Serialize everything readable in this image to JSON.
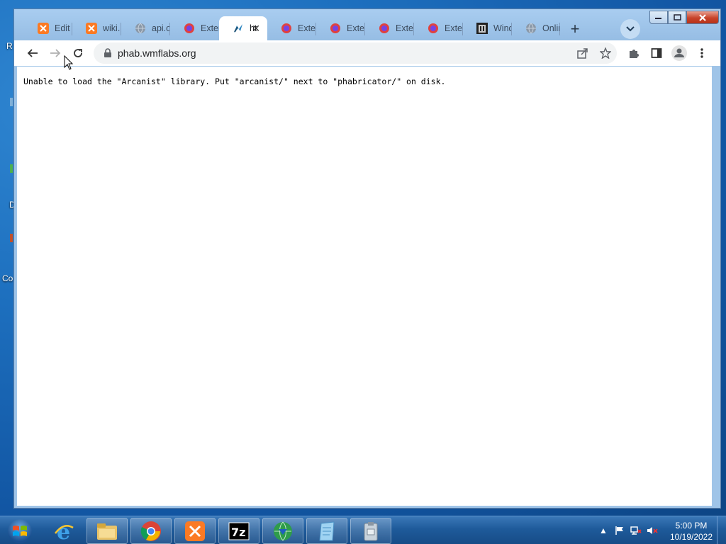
{
  "desktop": {
    "labels": [
      "R",
      "D",
      "Co"
    ]
  },
  "tabs": [
    {
      "label": "Edit L",
      "icon": "xampp-icon"
    },
    {
      "label": "wiki.p",
      "icon": "xampp-icon"
    },
    {
      "label": "api.o",
      "icon": "globe-icon"
    },
    {
      "label": "Exten",
      "icon": "firefox-icon"
    },
    {
      "label": "ht",
      "icon": "phabricator-icon"
    },
    {
      "label": "Exten",
      "icon": "firefox-icon"
    },
    {
      "label": "Exten",
      "icon": "firefox-icon"
    },
    {
      "label": "Exten",
      "icon": "firefox-icon"
    },
    {
      "label": "Exten",
      "icon": "firefox-icon"
    },
    {
      "label": "Wind",
      "icon": "wikipedia-icon"
    },
    {
      "label": "Onlin",
      "icon": "globe-icon"
    }
  ],
  "active_tab_index": 4,
  "toolbar": {
    "url": "phab.wmflabs.org"
  },
  "page": {
    "error_message": "Unable to load the \"Arcanist\" library. Put \"arcanist/\" next to \"phabricator/\" on disk."
  },
  "taskbar": {
    "items": [
      "internet-explorer",
      "file-explorer",
      "chrome",
      "xampp",
      "7zip",
      "app-globe",
      "notepad",
      "archive"
    ],
    "clock_time": "5:00 PM",
    "clock_date": "10/19/2022"
  }
}
